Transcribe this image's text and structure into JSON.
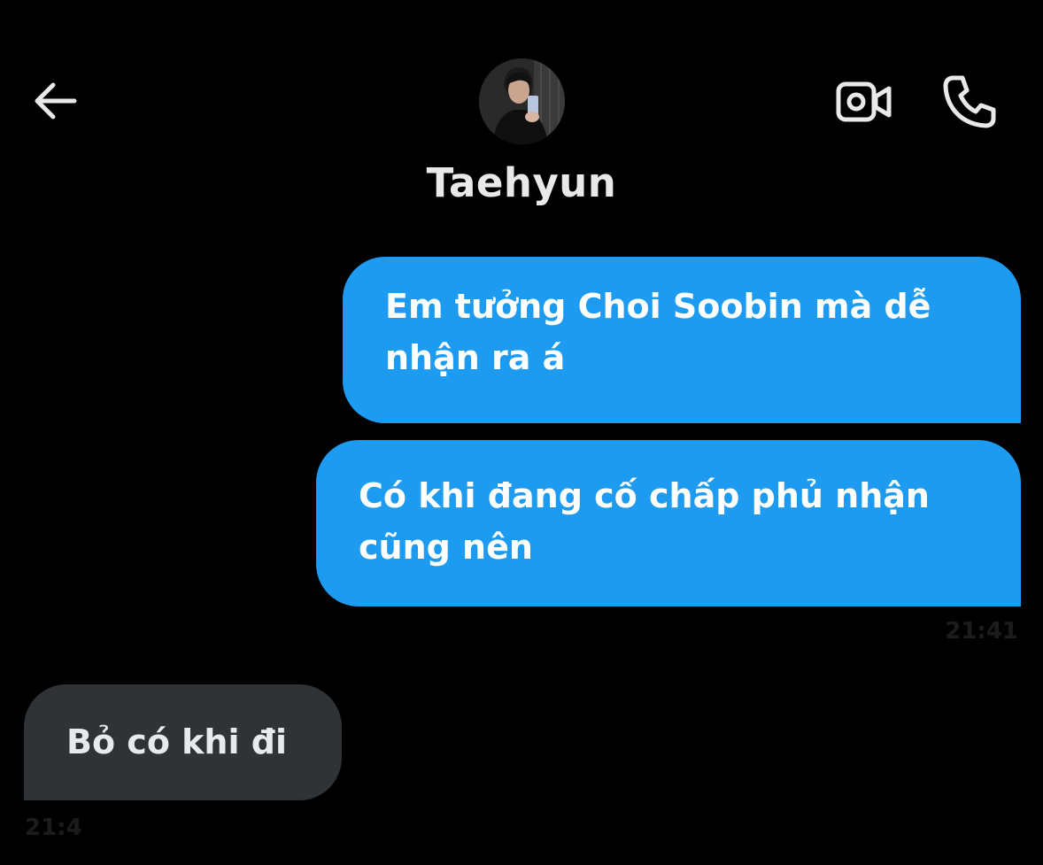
{
  "header": {
    "contact_name": "Taehyun",
    "back_icon": "back-arrow-icon",
    "video_icon": "video-camera-icon",
    "phone_icon": "phone-icon"
  },
  "messages": [
    {
      "direction": "sent",
      "text": "Em tưởng Choi Soobin mà dễ nhận ra á"
    },
    {
      "direction": "sent",
      "text": "Có khi đang cố chấp phủ nhận cũng nên"
    },
    {
      "direction": "received",
      "text": "Bỏ có khi đi"
    }
  ],
  "timestamps": {
    "sent": "21:41",
    "received": "21:4"
  },
  "colors": {
    "background": "#000000",
    "sent_bubble": "#1d9bf0",
    "received_bubble": "#2f3336",
    "text": "#e7e9ea"
  }
}
